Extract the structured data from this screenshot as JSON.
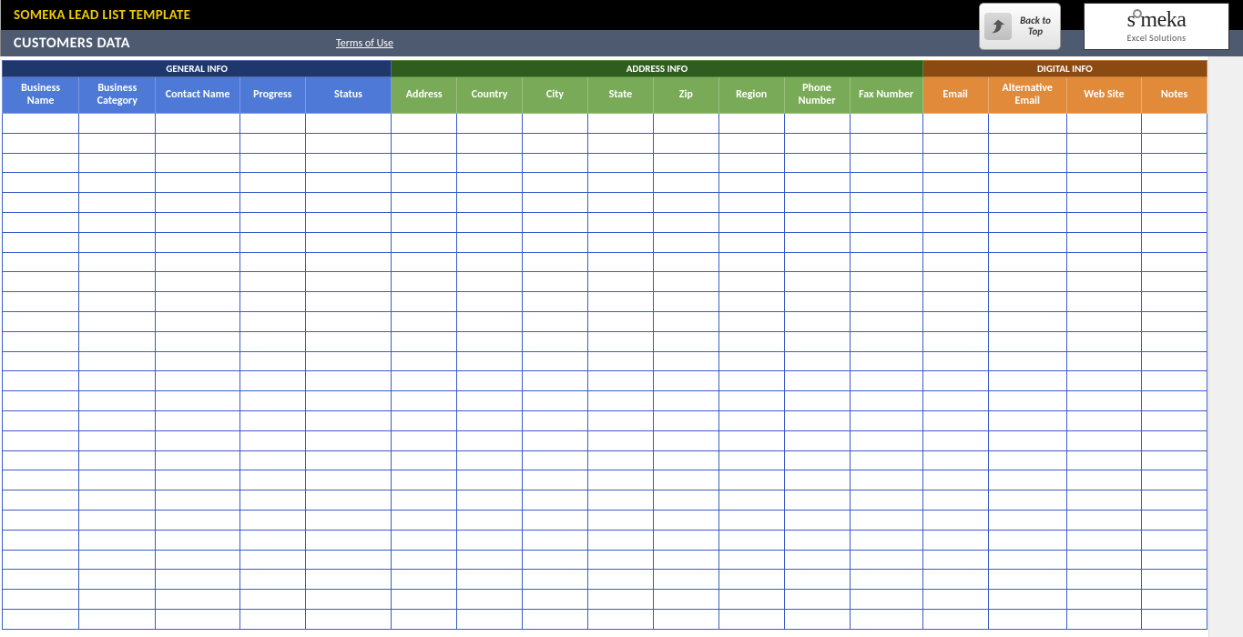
{
  "header": {
    "template_title": "SOMEKA LEAD LIST TEMPLATE",
    "back_to_top_line1": "Back to",
    "back_to_top_line2": "Top",
    "logo_main": "someka",
    "logo_sub": "Excel Solutions"
  },
  "subheader": {
    "title": "CUSTOMERS DATA",
    "terms": "Terms of Use"
  },
  "groups": {
    "general": "GENERAL INFO",
    "address": "ADDRESS INFO",
    "digital": "DIGITAL INFO"
  },
  "columns": {
    "general": [
      "Business Name",
      "Business Category",
      "Contact Name",
      "Progress",
      "Status"
    ],
    "address": [
      "Address",
      "Country",
      "City",
      "State",
      "Zip",
      "Region",
      "Phone Number",
      "Fax Number"
    ],
    "digital": [
      "Email",
      "Alternative Email",
      "Web Site",
      "Notes"
    ]
  },
  "data_row_count": 26
}
